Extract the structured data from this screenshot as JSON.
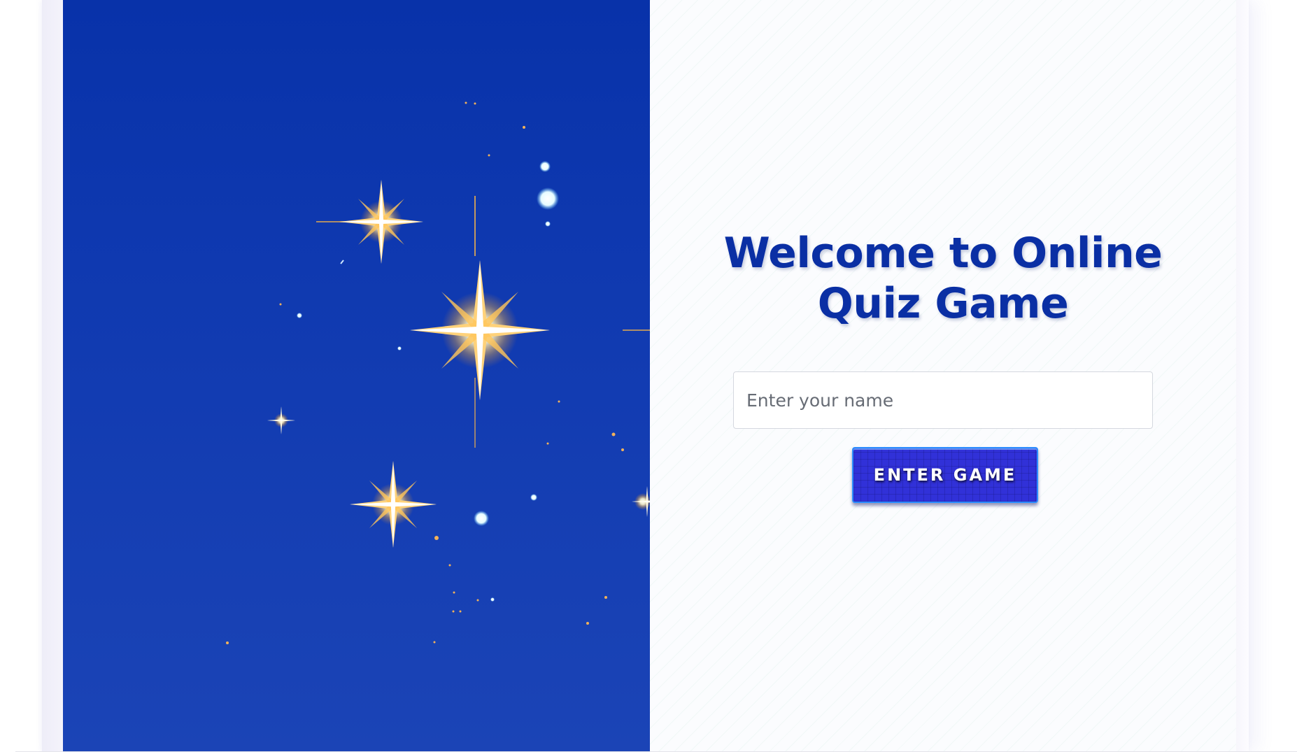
{
  "welcome": {
    "title_line1": "Welcome to Online",
    "title_line2": "Quiz Game"
  },
  "name_input": {
    "placeholder": "Enter your name",
    "value": ""
  },
  "enter_button": {
    "label": "ENTER GAME"
  },
  "hero": {
    "image": "sparkling-stars-illustration"
  },
  "colors": {
    "title": "#0a2fa4",
    "hero_background": "#0f39b0",
    "button": "#3131d8",
    "button_border": "#2c8cff"
  }
}
